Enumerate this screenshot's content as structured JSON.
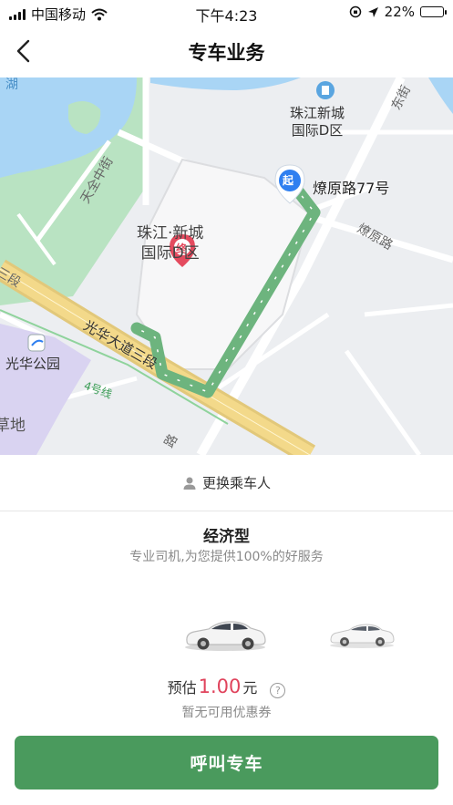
{
  "status_bar": {
    "carrier": "中国移动",
    "time": "下午4:23",
    "battery_percent": "22%",
    "battery_level": 0.22,
    "icons": [
      "signal-icon",
      "wifi-icon",
      "rotation-lock-icon",
      "location-arrow-icon",
      "battery-icon"
    ]
  },
  "nav": {
    "title": "专车业务",
    "back_icon": "chevron-left-icon"
  },
  "map": {
    "labels": {
      "lake": "湖",
      "tianfu_street": "天全中街",
      "kaiyuan_street_top": "东街",
      "poi_name_line1": "珠江新城",
      "poi_name_line2": "国际D区",
      "start_address": "燎原路77号",
      "liaoyuan_road": "燎原路",
      "destination_line1": "珠江·新城",
      "destination_line2": "国际D区",
      "sanduan": "三段",
      "guanghua_avenue": "光华大道三段",
      "guanghua_park": "光华公园",
      "metro_line": "4号线",
      "lawn": "草地",
      "bottom_road": "路"
    },
    "markers": {
      "start": "起",
      "end": "终"
    },
    "colors": {
      "route": "#6db47e",
      "water": "#a9d5f5",
      "park_green": "#b9e3c2",
      "main_road": "#f3d98a",
      "park_purple": "#d9d3f1"
    }
  },
  "passenger": {
    "label": "更换乘车人",
    "icon": "person-icon"
  },
  "service": {
    "title": "经济型",
    "description": "专业司机,为您提供100%的好服务",
    "cars": [
      "car-icon",
      "car-icon"
    ]
  },
  "price": {
    "prefix": "预估",
    "amount": "1.00",
    "unit": "元",
    "help_icon": "question-icon",
    "help_glyph": "?",
    "coupon_text": "暂无可用优惠券"
  },
  "action": {
    "call_label": "呼叫专车"
  }
}
